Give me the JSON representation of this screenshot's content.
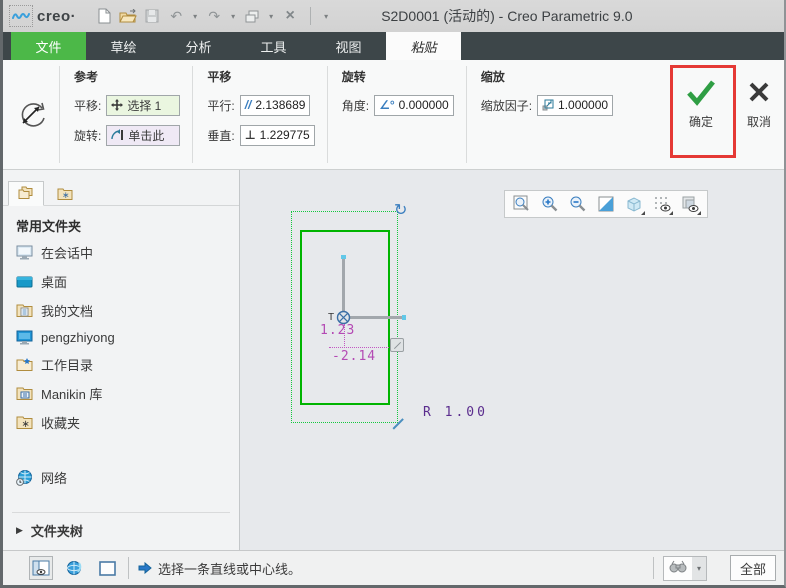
{
  "titlebar": {
    "brand": "creo·",
    "title": "S2D0001 (活动的) - Creo Parametric 9.0"
  },
  "icons": {
    "undo": "↶",
    "redo": "↷",
    "dropdown": "▾",
    "close": "×",
    "rotate_handle": "↻",
    "tree_expand": "▶"
  },
  "tabs": [
    {
      "label": "文件"
    },
    {
      "label": "草绘"
    },
    {
      "label": "分析"
    },
    {
      "label": "工具"
    },
    {
      "label": "视图"
    },
    {
      "label": "粘贴"
    }
  ],
  "ribbon": {
    "reference": {
      "title": "参考",
      "translate_label": "平移:",
      "translate_value": "选择 1",
      "rotate_label": "旋转:",
      "rotate_value": "单击此"
    },
    "translate": {
      "title": "平移",
      "parallel_label": "平行:",
      "parallel_icon": "//",
      "parallel_value": "2.138689",
      "vertical_label": "垂直:",
      "vertical_icon": "⊥",
      "vertical_value": "1.229775"
    },
    "rotate": {
      "title": "旋转",
      "angle_label": "角度:",
      "angle_icon": "∠°",
      "angle_value": "0.000000"
    },
    "scale": {
      "title": "缩放",
      "factor_label": "缩放因子:",
      "factor_value": "1.000000"
    },
    "ok_label": "确定",
    "cancel_label": "取消"
  },
  "navigator": {
    "header": "常用文件夹",
    "items": [
      {
        "icon": "in-session-monitor",
        "label": "在会话中"
      },
      {
        "icon": "desktop",
        "label": "桌面"
      },
      {
        "icon": "my-documents-folder",
        "label": "我的文档"
      },
      {
        "icon": "workstation",
        "label": "pengzhiyong"
      },
      {
        "icon": "working-directory-folder",
        "label": "工作目录"
      },
      {
        "icon": "manikin-library-folder",
        "label": "Manikin 库"
      },
      {
        "icon": "favorites-folder",
        "label": "收藏夹"
      },
      {
        "icon": "network-globe",
        "label": "网络"
      }
    ],
    "footer": "文件夹树"
  },
  "canvas": {
    "origin_label": "T",
    "dim_vertical": "1.23",
    "dim_horizontal": "-2.14",
    "dim_radius": "R 1.00"
  },
  "statusbar": {
    "message": "选择一条直线或中心线。",
    "filter": "全部"
  },
  "colors": {
    "accent_green": "#4cb848",
    "selection_green": "#12c83e",
    "sketch_green": "#00b400",
    "dimension_magenta": "#b44ab4",
    "radius_purple": "#5b2d8e",
    "annotation_red": "#e53935"
  }
}
